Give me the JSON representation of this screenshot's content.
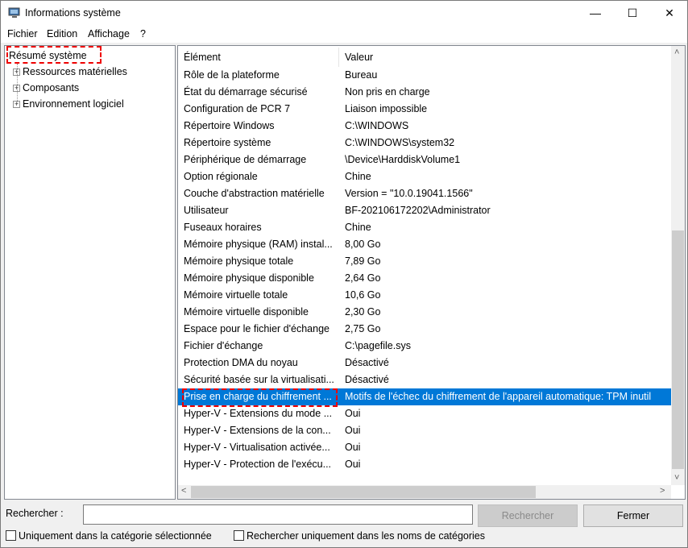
{
  "window": {
    "title": "Informations système",
    "minimize": "—",
    "maximize": "☐",
    "close": "✕"
  },
  "menu": [
    "Fichier",
    "Edition",
    "Affichage",
    "?"
  ],
  "tree": [
    {
      "label": "Résumé système"
    },
    {
      "label": "Ressources matérielles"
    },
    {
      "label": "Composants"
    },
    {
      "label": "Environnement logiciel"
    }
  ],
  "table": {
    "headers": [
      "Élément",
      "Valeur"
    ],
    "rows": [
      [
        "Rôle de la plateforme",
        "Bureau"
      ],
      [
        "État du démarrage sécurisé",
        "Non pris en charge"
      ],
      [
        "Configuration de PCR 7",
        "Liaison impossible"
      ],
      [
        "Répertoire Windows",
        "C:\\WINDOWS"
      ],
      [
        "Répertoire système",
        "C:\\WINDOWS\\system32"
      ],
      [
        "Périphérique de démarrage",
        "\\Device\\HarddiskVolume1"
      ],
      [
        "Option régionale",
        "Chine"
      ],
      [
        "Couche d'abstraction matérielle",
        "Version = \"10.0.19041.1566\""
      ],
      [
        "Utilisateur",
        "BF-202106172202\\Administrator"
      ],
      [
        "Fuseaux horaires",
        "Chine"
      ],
      [
        "Mémoire physique (RAM) instal...",
        "8,00 Go"
      ],
      [
        "Mémoire physique totale",
        "7,89 Go"
      ],
      [
        "Mémoire physique disponible",
        "2,64 Go"
      ],
      [
        "Mémoire virtuelle totale",
        "10,6 Go"
      ],
      [
        "Mémoire virtuelle disponible",
        "2,30 Go"
      ],
      [
        "Espace pour le fichier d'échange",
        "2,75 Go"
      ],
      [
        "Fichier d'échange",
        "C:\\pagefile.sys"
      ],
      [
        "Protection DMA du noyau",
        "Désactivé"
      ],
      [
        "Sécurité basée sur la virtualisati...",
        "Désactivé"
      ],
      [
        "Prise en charge du chiffrement ...",
        "Motifs de l'échec du chiffrement de l'appareil automatique: TPM inutil"
      ],
      [
        "Hyper-V - Extensions du mode ...",
        "Oui"
      ],
      [
        "Hyper-V - Extensions de la con...",
        "Oui"
      ],
      [
        "Hyper-V - Virtualisation activée...",
        "Oui"
      ],
      [
        "Hyper-V - Protection de l'exécu...",
        "Oui"
      ]
    ],
    "selected_index": 19
  },
  "search": {
    "label": "Rechercher :",
    "value": "",
    "search_button": "Rechercher",
    "close_button": "Fermer",
    "checkbox1": "Uniquement dans la catégorie sélectionnée",
    "checkbox2": "Rechercher uniquement dans les noms de catégories"
  }
}
